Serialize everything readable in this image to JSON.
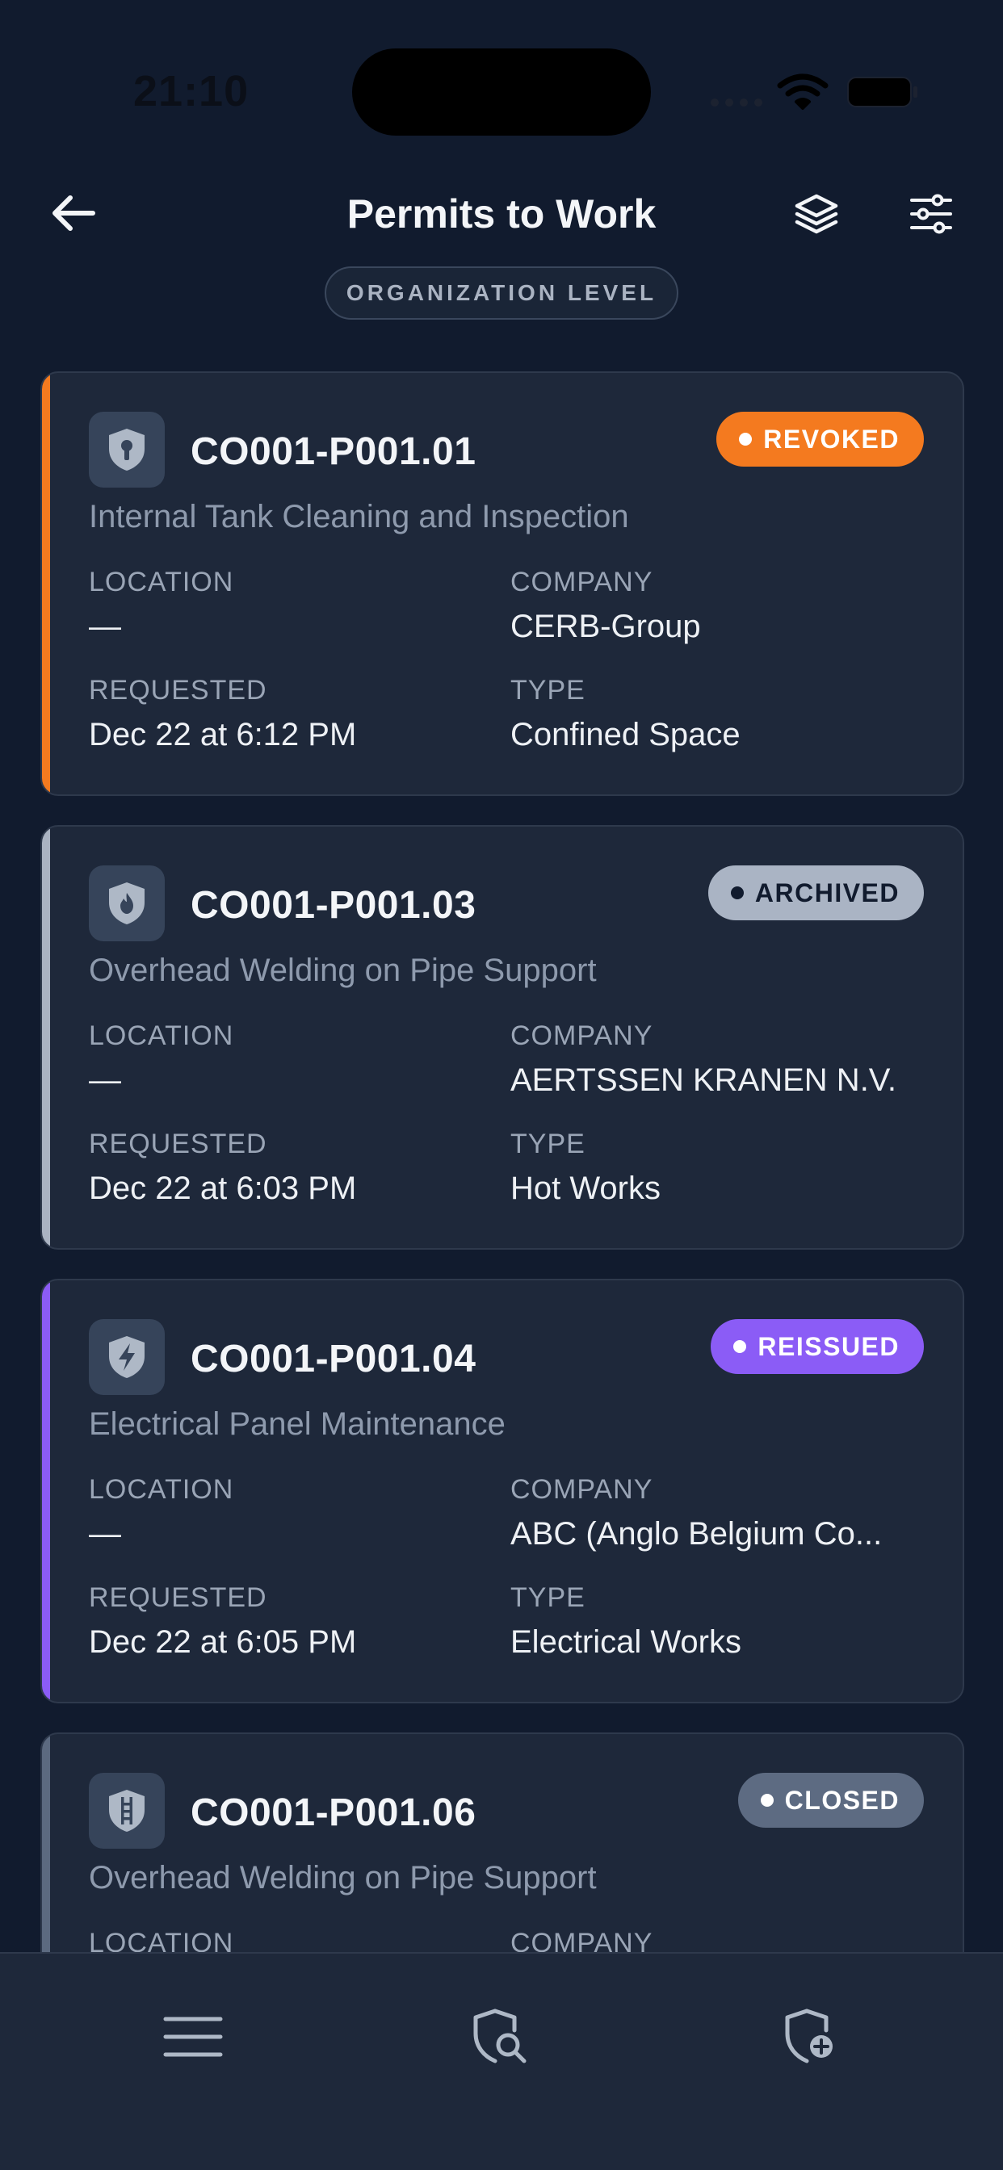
{
  "status_bar": {
    "time": "21:10"
  },
  "header": {
    "title": "Permits to Work",
    "scope": "ORGANIZATION LEVEL"
  },
  "labels": {
    "location": "LOCATION",
    "company": "COMPANY",
    "requested": "REQUESTED",
    "type": "TYPE"
  },
  "permits": [
    {
      "id": "CO001-P001.01",
      "description": "Internal Tank Cleaning and Inspection",
      "status": "REVOKED",
      "location": "—",
      "company": "CERB-Group",
      "requested": "Dec 22 at 6:12 PM",
      "type": "Confined Space",
      "icon": "keyhole-shield-icon",
      "accent_color": "#f47a1f"
    },
    {
      "id": "CO001-P001.03",
      "description": "Overhead Welding on Pipe Support",
      "status": "ARCHIVED",
      "location": "—",
      "company": "AERTSSEN KRANEN N.V.",
      "requested": "Dec 22 at 6:03 PM",
      "type": "Hot Works",
      "icon": "flame-shield-icon",
      "accent_color": "#aab3c2"
    },
    {
      "id": "CO001-P001.04",
      "description": "Electrical Panel Maintenance",
      "status": "REISSUED",
      "location": "—",
      "company": "ABC (Anglo Belgium Co...",
      "requested": "Dec 22 at 6:05 PM",
      "type": "Electrical Works",
      "icon": "lightning-shield-icon",
      "accent_color": "#8b5cf6"
    },
    {
      "id": "CO001-P001.06",
      "description": "Overhead Welding on Pipe Support",
      "status": "CLOSED",
      "location": "",
      "company": "",
      "requested": "",
      "type": "",
      "icon": "ladder-shield-icon",
      "accent_color": "#5c6a80"
    }
  ],
  "tabs": [
    {
      "icon": "menu-icon"
    },
    {
      "icon": "search-shield-icon"
    },
    {
      "icon": "add-shield-icon"
    }
  ]
}
